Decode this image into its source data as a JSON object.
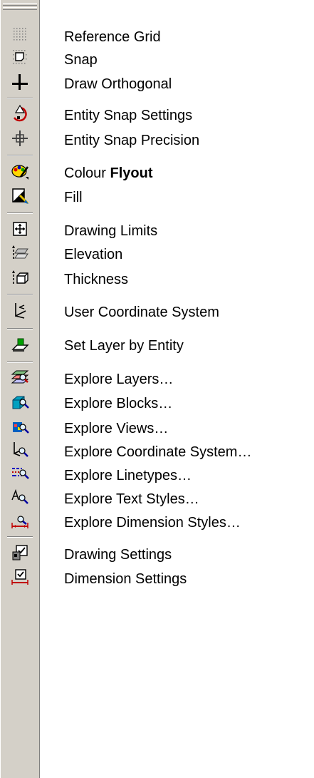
{
  "items": [
    {
      "icon": "reference-grid-icon",
      "label": "Reference Grid"
    },
    {
      "icon": "snap-icon",
      "label": "Snap"
    },
    {
      "icon": "draw-orthogonal-icon",
      "label": "Draw Orthogonal"
    },
    {
      "icon": "entity-snap-settings-icon",
      "label": "Entity Snap Settings"
    },
    {
      "icon": "entity-snap-precision-icon",
      "label": "Entity Snap Precision"
    },
    {
      "icon": "colour-flyout-icon",
      "label": "Colour ",
      "label_bold": "Flyout"
    },
    {
      "icon": "fill-icon",
      "label": "Fill"
    },
    {
      "icon": "drawing-limits-icon",
      "label": "Drawing Limits"
    },
    {
      "icon": "elevation-icon",
      "label": "Elevation"
    },
    {
      "icon": "thickness-icon",
      "label": "Thickness"
    },
    {
      "icon": "user-coordinate-system-icon",
      "label": "User Coordinate System"
    },
    {
      "icon": "set-layer-by-entity-icon",
      "label": "Set Layer by Entity"
    },
    {
      "icon": "explore-layers-icon",
      "label": "Explore Layers…"
    },
    {
      "icon": "explore-blocks-icon",
      "label": "Explore Blocks…"
    },
    {
      "icon": "explore-views-icon",
      "label": "Explore Views…"
    },
    {
      "icon": "explore-coordinate-system-icon",
      "label": "Explore Coordinate System…"
    },
    {
      "icon": "explore-linetypes-icon",
      "label": "Explore Linetypes…"
    },
    {
      "icon": "explore-text-styles-icon",
      "label": "Explore Text Styles…"
    },
    {
      "icon": "explore-dimension-styles-icon",
      "label": "Explore Dimension Styles…"
    },
    {
      "icon": "drawing-settings-icon",
      "label": "Drawing Settings"
    },
    {
      "icon": "dimension-settings-icon",
      "label": "Dimension Settings"
    }
  ]
}
